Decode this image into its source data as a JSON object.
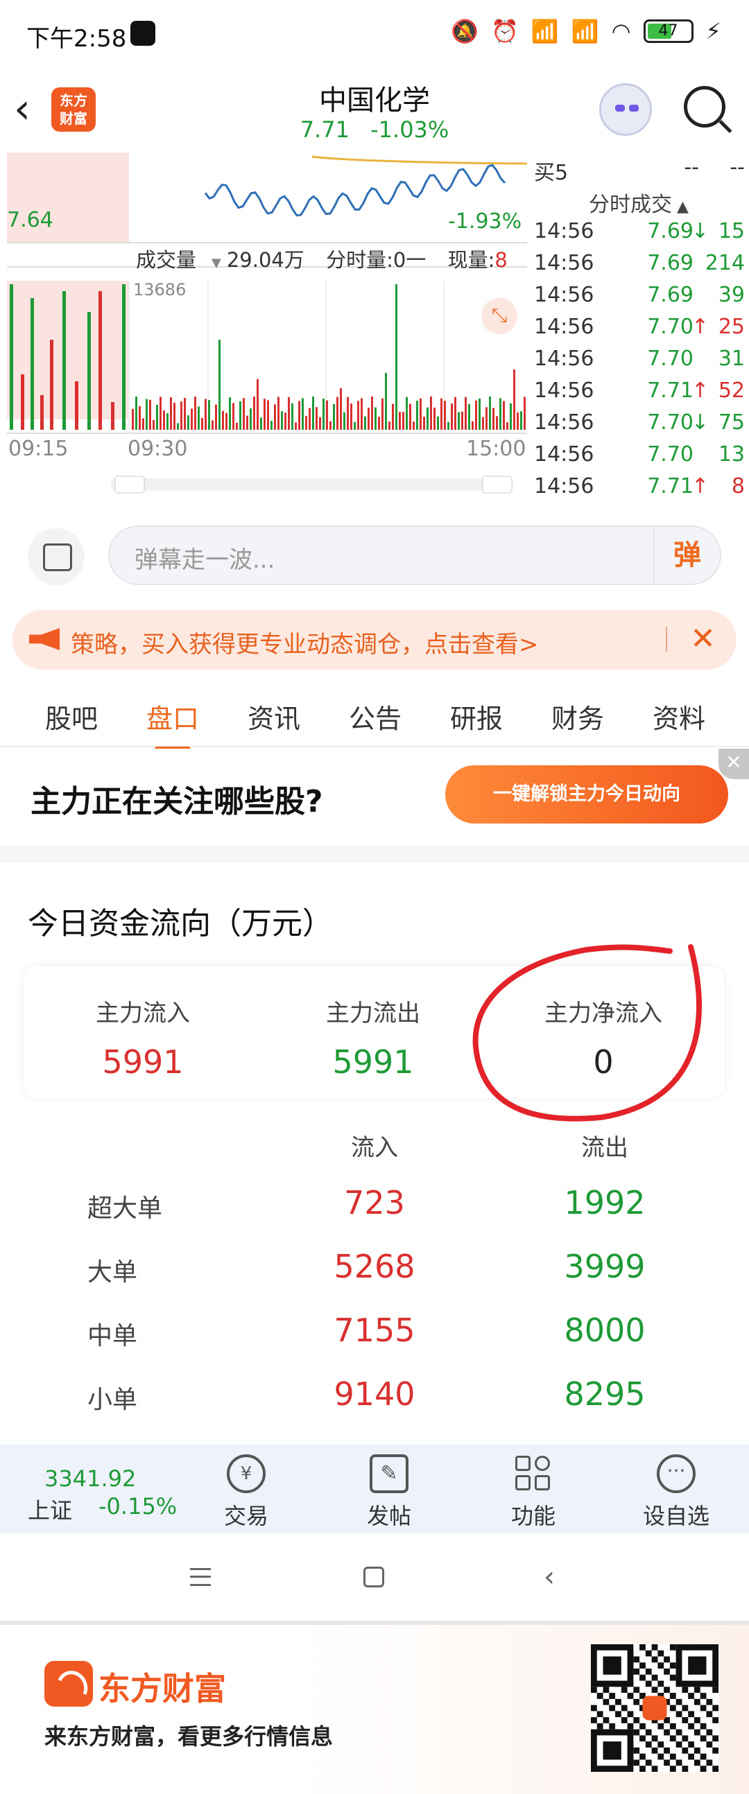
{
  "status_bar": {
    "time": "下午2:58",
    "battery": "47"
  },
  "header": {
    "back_icon": "chevron-left-icon",
    "logo_text": "东方\n财富",
    "stock_name": "中国化学",
    "price": "7.71",
    "change_pct": "-1.03%"
  },
  "chart": {
    "price_low_label": "7.64",
    "pct_low_label": "-1.93%",
    "volume_label": "成交量",
    "volume_value": "29.04万",
    "minute_volume": "分时量:0一",
    "current_volume_label": "现量:",
    "current_volume_value": "8",
    "volume_max": "13686",
    "x_labels": [
      "09:15",
      "09:30",
      "15:00"
    ]
  },
  "chart_data": {
    "type": "line",
    "title": "",
    "x": [
      "09:15",
      "09:30",
      "15:00"
    ],
    "series": [
      {
        "values": [
          7.72,
          7.7,
          7.66,
          7.65,
          7.66,
          7.67,
          7.68,
          7.7,
          7.69,
          7.71
        ]
      }
    ],
    "volume_max": 13686
  },
  "trades": {
    "bid5_label": "买5",
    "bid5_price": "--",
    "bid5_vol": "--",
    "header": "分时成交",
    "rows": [
      {
        "time": "14:56",
        "price": "7.69",
        "dir": "↓",
        "vol": "15",
        "color": "green"
      },
      {
        "time": "14:56",
        "price": "7.69",
        "dir": "",
        "vol": "214",
        "color": "green"
      },
      {
        "time": "14:56",
        "price": "7.69",
        "dir": "",
        "vol": "39",
        "color": "green"
      },
      {
        "time": "14:56",
        "price": "7.70",
        "dir": "↑",
        "vol": "25",
        "color": "red"
      },
      {
        "time": "14:56",
        "price": "7.70",
        "dir": "",
        "vol": "31",
        "color": "green"
      },
      {
        "time": "14:56",
        "price": "7.71",
        "dir": "↑",
        "vol": "52",
        "color": "red"
      },
      {
        "time": "14:56",
        "price": "7.70",
        "dir": "↓",
        "vol": "75",
        "color": "green"
      },
      {
        "time": "14:56",
        "price": "7.70",
        "dir": "",
        "vol": "13",
        "color": "green"
      },
      {
        "time": "14:56",
        "price": "7.71",
        "dir": "↑",
        "vol": "8",
        "color": "red"
      }
    ]
  },
  "danmaku": {
    "placeholder": "弹幕走一波...",
    "send_label": "弹"
  },
  "promo": {
    "text": "策略，买入获得更专业动态调仓，点击查看>"
  },
  "tabs": [
    "股吧",
    "盘口",
    "资讯",
    "公告",
    "研报",
    "财务",
    "资料"
  ],
  "active_tab": "盘口",
  "mainforce": {
    "question": "主力正在关注哪些股?",
    "button": "一键解锁主力今日动向"
  },
  "fund_flow": {
    "title": "今日资金流向（万元）",
    "summary": [
      {
        "label": "主力流入",
        "value": "5991",
        "color": "red"
      },
      {
        "label": "主力流出",
        "value": "5991",
        "color": "green"
      },
      {
        "label": "主力净流入",
        "value": "0",
        "color": "black"
      }
    ],
    "col_in": "流入",
    "col_out": "流出",
    "rows": [
      {
        "label": "超大单",
        "in": "723",
        "out": "1992"
      },
      {
        "label": "大单",
        "in": "5268",
        "out": "3999"
      },
      {
        "label": "中单",
        "in": "7155",
        "out": "8000"
      },
      {
        "label": "小单",
        "in": "9140",
        "out": "8295"
      }
    ]
  },
  "bottom_nav": {
    "index_value": "3341.92",
    "index_name": "上证",
    "index_change": "-0.15%",
    "items": [
      {
        "label": "交易",
        "icon": "yen-refresh-icon"
      },
      {
        "label": "发帖",
        "icon": "edit-icon"
      },
      {
        "label": "功能",
        "icon": "grid-icon"
      },
      {
        "label": "设自选",
        "icon": "more-icon"
      }
    ]
  },
  "footer": {
    "brand": "东方财富",
    "slogan": "来东方财富，看更多行情信息"
  }
}
